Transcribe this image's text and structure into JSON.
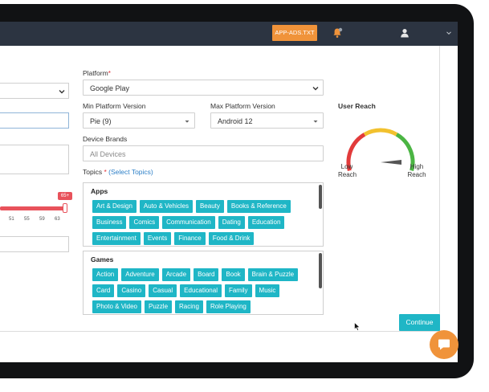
{
  "topbar": {
    "app_ads_label": "APP-ADS.TXT",
    "icons": {
      "notifications": "bell-icon",
      "profile": "user-icon",
      "menu": "chevron-down-icon"
    }
  },
  "slider": {
    "tip": "65+",
    "ticks": [
      "51",
      "55",
      "59",
      "63"
    ]
  },
  "form": {
    "platform": {
      "label": "Platform",
      "required_mark": "*",
      "value": "Google Play"
    },
    "min_version": {
      "label": "Min Platform Version",
      "value": "Pie (9)"
    },
    "max_version": {
      "label": "Max Platform Version",
      "value": "Android 12"
    },
    "device_brands": {
      "label": "Device Brands",
      "placeholder": "All Devices"
    },
    "topics": {
      "label": "Topics",
      "required_mark": "*",
      "link": "(Select Topics)"
    }
  },
  "topic_groups": [
    {
      "title": "Apps",
      "items": [
        "Art & Design",
        "Auto & Vehicles",
        "Beauty",
        "Books & Reference",
        "Business",
        "Comics",
        "Communication",
        "Dating",
        "Education",
        "Entertainment",
        "Events",
        "Finance",
        "Food & Drink"
      ]
    },
    {
      "title": "Games",
      "items": [
        "Action",
        "Adventure",
        "Arcade",
        "Board",
        "Book",
        "Brain & Puzzle",
        "Card",
        "Casino",
        "Casual",
        "Educational",
        "Family",
        "Music",
        "Photo & Video",
        "Puzzle",
        "Racing",
        "Role Playing"
      ]
    }
  ],
  "reach": {
    "title": "User Reach",
    "low_label": "Low Reach",
    "high_label": "High Reach",
    "colors": {
      "low": "#e23b3b",
      "mid": "#f2c12e",
      "high": "#4bb543"
    }
  },
  "actions": {
    "continue_label": "Continue"
  },
  "colors": {
    "accent": "#1fb6c6",
    "orange": "#f0933a",
    "topbar": "#2c3441"
  }
}
